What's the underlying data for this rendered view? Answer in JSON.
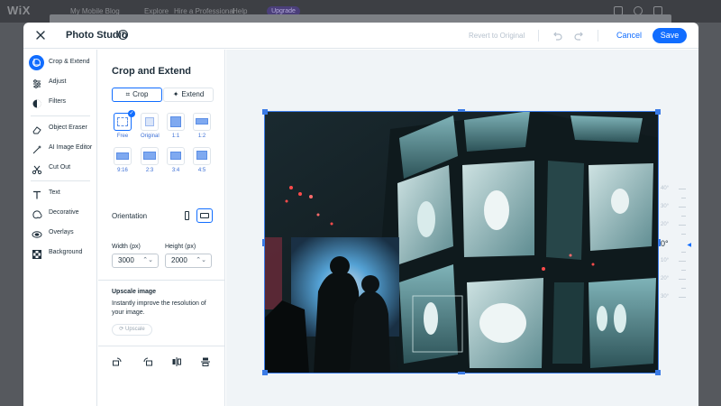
{
  "background": {
    "logo": "WiX",
    "site_name": "My Mobile Blog",
    "menu": [
      "Explore",
      "Hire a Professional",
      "Help"
    ],
    "upgrade_label": "Upgrade"
  },
  "header": {
    "title": "Photo Studio",
    "help_glyph": "?",
    "revert_label": "Revert to Original",
    "cancel_label": "Cancel",
    "save_label": "Save"
  },
  "nav": {
    "items": [
      {
        "label": "Crop & Extend",
        "icon": "crop-extend-icon",
        "active": true
      },
      {
        "label": "Adjust",
        "icon": "adjust-icon"
      },
      {
        "label": "Filters",
        "icon": "filters-icon"
      },
      {
        "label": "Object Eraser",
        "icon": "eraser-icon"
      },
      {
        "label": "AI Image Editor",
        "icon": "ai-edit-icon"
      },
      {
        "label": "Cut Out",
        "icon": "cutout-icon"
      },
      {
        "label": "Text",
        "icon": "text-icon"
      },
      {
        "label": "Decorative",
        "icon": "decorative-icon"
      },
      {
        "label": "Overlays",
        "icon": "overlays-icon"
      },
      {
        "label": "Background",
        "icon": "background-icon"
      }
    ]
  },
  "panel": {
    "title": "Crop and Extend",
    "crop_label": "Crop",
    "extend_label": "Extend",
    "ratios": [
      {
        "label": "Free",
        "selected": true
      },
      {
        "label": "Original"
      },
      {
        "label": "1:1"
      },
      {
        "label": "1:2"
      },
      {
        "label": "9:16"
      },
      {
        "label": "2:3"
      },
      {
        "label": "3:4"
      },
      {
        "label": "4:5"
      }
    ],
    "orientation_label": "Orientation",
    "orientation_selected": "landscape",
    "width_label": "Width (px)",
    "width_value": "3000",
    "height_label": "Height (px)",
    "height_value": "2000",
    "upscale_title": "Upscale image",
    "upscale_desc": "Instantly improve the resolution of your image.",
    "upscale_button": "Upscale"
  },
  "canvas": {
    "rotation_value": "0°",
    "dial_labels": [
      "40°",
      "30°",
      "20°",
      "10°",
      "10°",
      "20°",
      "30°",
      "40°"
    ]
  },
  "colors": {
    "accent": "#116dff",
    "frame": "#3b7be6"
  }
}
